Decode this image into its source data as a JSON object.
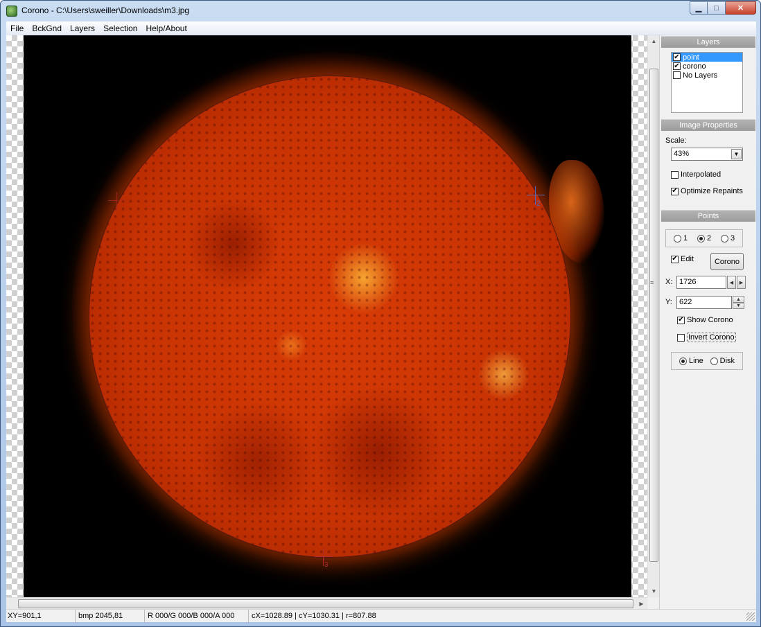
{
  "window": {
    "title": "Corono - C:\\Users\\sweiller\\Downloads\\m3.jpg",
    "min_glyph": "▁",
    "max_glyph": "□",
    "close_glyph": "✕"
  },
  "menu": [
    "File",
    "BckGnd",
    "Layers",
    "Selection",
    "Help/About"
  ],
  "canvas": {
    "markers": [
      {
        "label": "2",
        "color": "blue"
      },
      {
        "label": "3",
        "color": "red"
      }
    ]
  },
  "panel": {
    "layers": {
      "header": "Layers",
      "items": [
        {
          "label": "point",
          "checked": true,
          "selected": true
        },
        {
          "label": "corono",
          "checked": true,
          "selected": false
        },
        {
          "label": "No Layers",
          "checked": false,
          "selected": false
        }
      ]
    },
    "image_properties": {
      "header": "Image Properties",
      "scale_label": "Scale:",
      "scale_value": "43%",
      "interpolated_label": "Interpolated",
      "interpolated": false,
      "optimize_label": "Optimize Repaints",
      "optimize": true
    },
    "points": {
      "header": "Points",
      "options": [
        "1",
        "2",
        "3"
      ],
      "selected": "2",
      "edit_label": "Edit",
      "edit": true,
      "corono_button": "Corono",
      "x_label": "X:",
      "x_value": "1726",
      "y_label": "Y:",
      "y_value": "622",
      "show_corono_label": "Show Corono",
      "show_corono": true,
      "invert_corono_label": "Invert Corono",
      "invert_corono": false,
      "mode_options": [
        "Line",
        "Disk"
      ],
      "mode_selected": "Line"
    }
  },
  "status": {
    "xy": "XY=901,1",
    "bmp": "bmp 2045,81",
    "rgba": "R 000/G 000/B 000/A 000",
    "circle": "cX=1028.89 | cY=1030.31 | r=807.88"
  },
  "check_glyph": "✔",
  "icons": {
    "scroll_up": "▲",
    "scroll_down": "▼",
    "scroll_right": "▶",
    "combo_arrow": "▼",
    "spin_left": "◀",
    "spin_right": "▶",
    "spin_up": "▲",
    "spin_down": "▼",
    "grip": "≡"
  }
}
